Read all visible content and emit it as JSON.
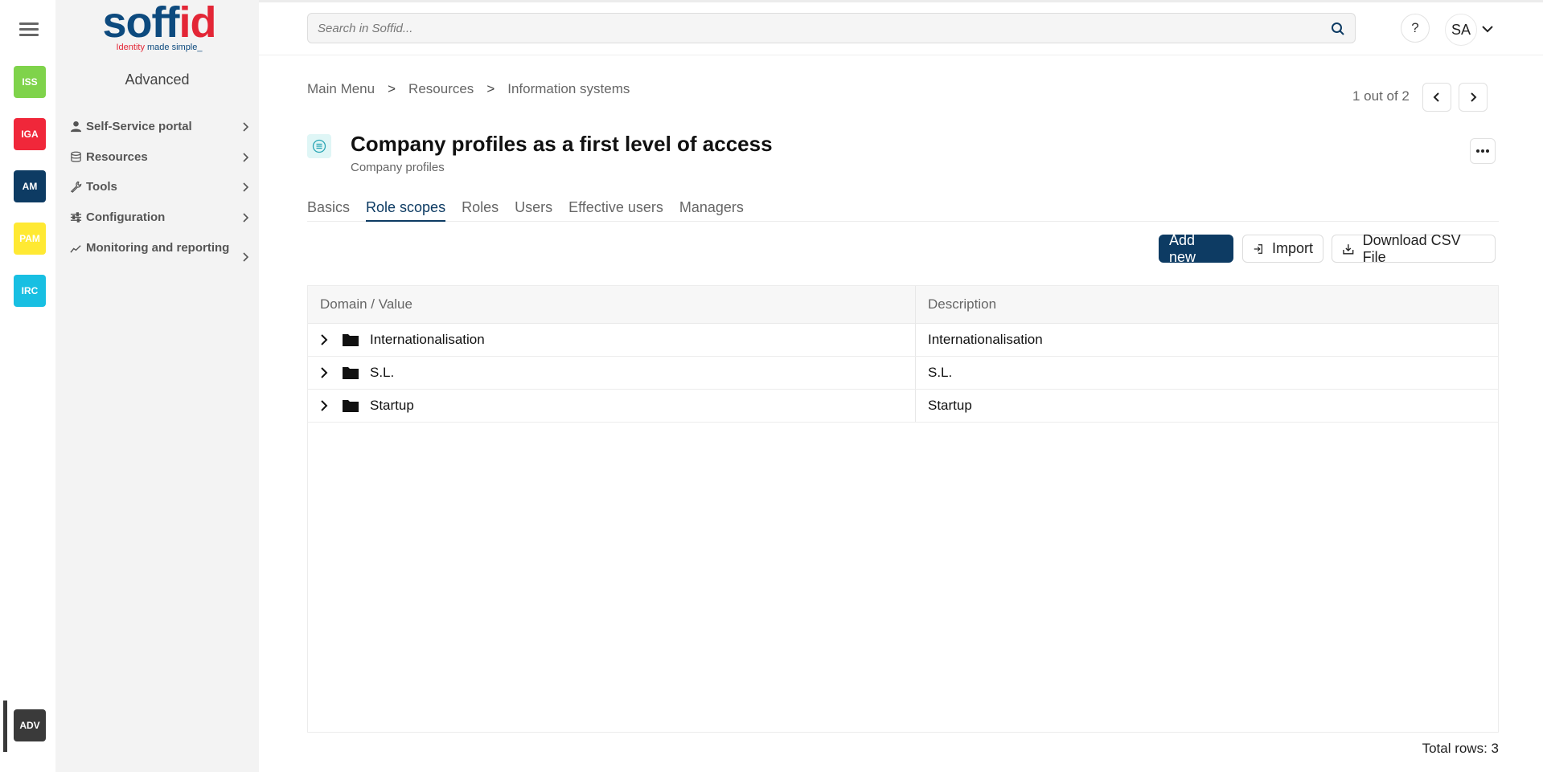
{
  "rail": {
    "modules": [
      {
        "label": "ISS",
        "color": "#7fd34b"
      },
      {
        "label": "IGA",
        "color": "#f0273a"
      },
      {
        "label": "AM",
        "color": "#0d3b63"
      },
      {
        "label": "PAM",
        "color": "#ffe933"
      },
      {
        "label": "IRC",
        "color": "#18bfe2"
      },
      {
        "label": "ADV",
        "color": "#3a3a3a"
      }
    ]
  },
  "logo": {
    "word_a": "soff",
    "word_b": "id",
    "tag_a": "Identity",
    "tag_b": " made simple_"
  },
  "sidebar": {
    "title": "Advanced",
    "items": [
      {
        "label": "Self-Service portal",
        "icon": "user-icon"
      },
      {
        "label": "Resources",
        "icon": "database-icon"
      },
      {
        "label": "Tools",
        "icon": "wrench-icon"
      },
      {
        "label": "Configuration",
        "icon": "sliders-icon"
      },
      {
        "label": "Monitoring and reporting",
        "icon": "chart-line-icon"
      }
    ]
  },
  "header": {
    "search_placeholder": "Search in Soffid...",
    "help_label": "?",
    "avatar_initials": "SA"
  },
  "breadcrumb": [
    "Main Menu",
    "Resources",
    "Information systems"
  ],
  "breadcrumb_sep": ">",
  "pager": {
    "text": "1 out of 2"
  },
  "object": {
    "title": "Company profiles as a first level of access",
    "subtitle": "Company profiles"
  },
  "tabs": [
    "Basics",
    "Role scopes",
    "Roles",
    "Users",
    "Effective users",
    "Managers"
  ],
  "active_tab": "Role scopes",
  "actions": {
    "add_new": "Add new",
    "import": "Import",
    "download_csv": "Download CSV File"
  },
  "table": {
    "columns": [
      "Domain / Value",
      "Description"
    ],
    "rows": [
      {
        "value": "Internationalisation",
        "description": "Internationalisation"
      },
      {
        "value": "S.L.",
        "description": "S.L."
      },
      {
        "value": "Startup",
        "description": "Startup"
      }
    ]
  },
  "footer": {
    "total_rows": "Total rows: 3"
  },
  "colors": {
    "primary": "#0d3b63",
    "brand_red": "#e32636",
    "brand_blue": "#0d4a7e"
  }
}
